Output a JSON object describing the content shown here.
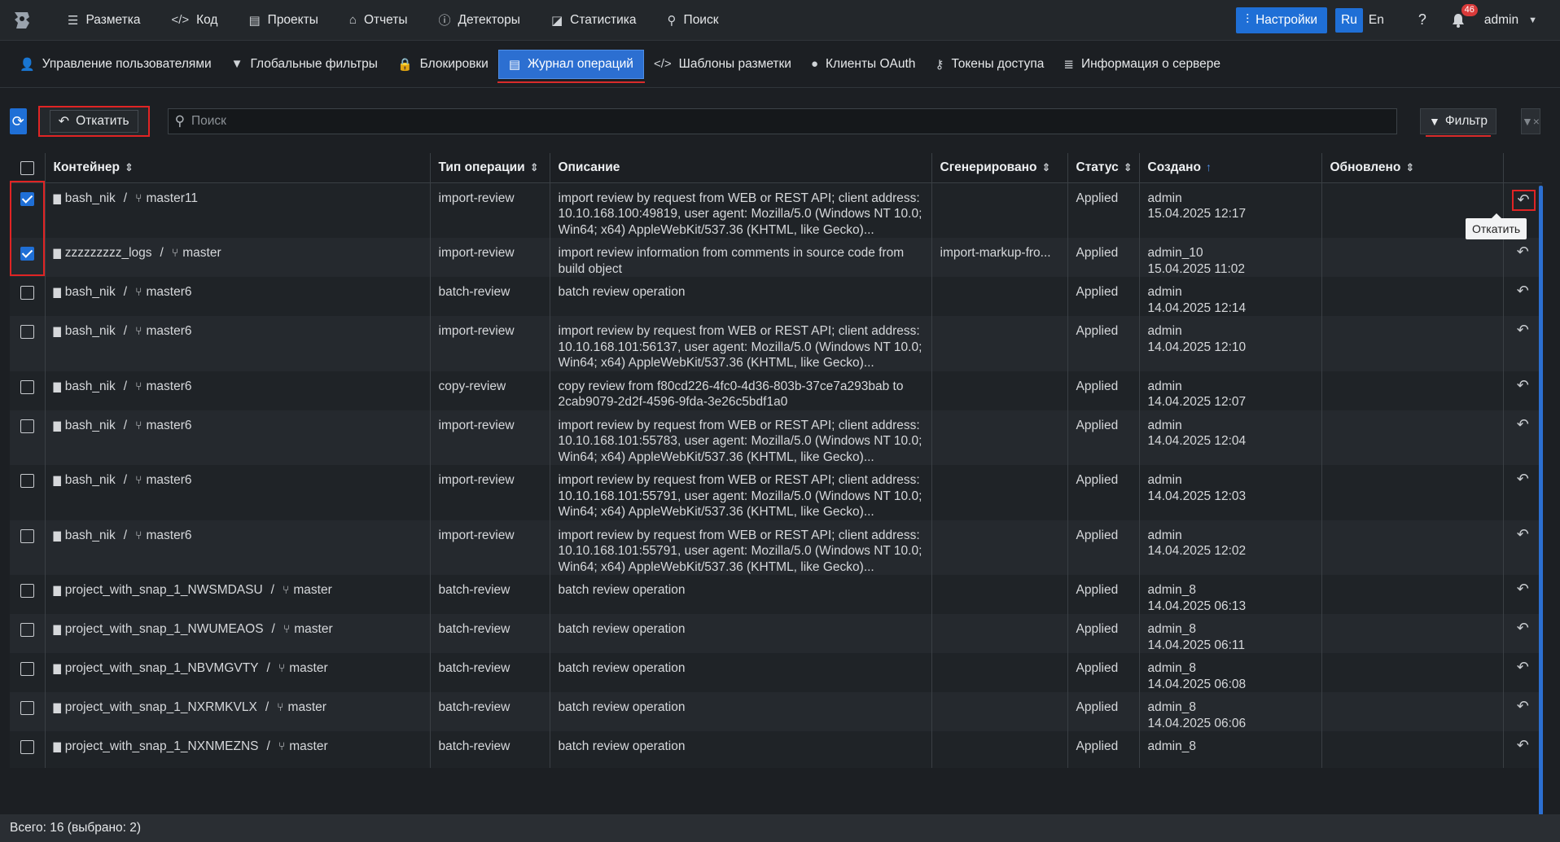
{
  "topnav": {
    "items": [
      {
        "label": "Разметка",
        "icon": "list-icon",
        "glyph": "☰"
      },
      {
        "label": "Код",
        "icon": "code-icon",
        "glyph": "</>"
      },
      {
        "label": "Проекты",
        "icon": "archive-icon",
        "glyph": "▤"
      },
      {
        "label": "Отчеты",
        "icon": "reports-icon",
        "glyph": "⌂"
      },
      {
        "label": "Детекторы",
        "icon": "detector-icon",
        "glyph": "ⓘ"
      },
      {
        "label": "Статистика",
        "icon": "chart-icon",
        "glyph": "◪"
      },
      {
        "label": "Поиск",
        "icon": "search-icon",
        "glyph": "⚲"
      }
    ],
    "settings_label": "Настройки",
    "lang_ru": "Ru",
    "lang_en": "En",
    "notifications_count": "46",
    "user": "admin"
  },
  "subnav": {
    "items": [
      {
        "label": "Управление пользователями",
        "icon": "users-icon",
        "glyph": "👤",
        "active": false
      },
      {
        "label": "Глобальные фильтры",
        "icon": "filter-icon",
        "glyph": "▼",
        "active": false
      },
      {
        "label": "Блокировки",
        "icon": "lock-icon",
        "glyph": "🔒",
        "active": false
      },
      {
        "label": "Журнал операций",
        "icon": "journal-icon",
        "glyph": "▤",
        "active": true
      },
      {
        "label": "Шаблоны разметки",
        "icon": "code-icon",
        "glyph": "</>",
        "active": false
      },
      {
        "label": "Клиенты OAuth",
        "icon": "client-icon",
        "glyph": "●",
        "active": false
      },
      {
        "label": "Токены доступа",
        "icon": "key-icon",
        "glyph": "⚷",
        "active": false
      },
      {
        "label": "Информация о сервере",
        "icon": "database-icon",
        "glyph": "≣",
        "active": false
      }
    ]
  },
  "toolbar": {
    "rollback_label": "Откатить",
    "search_placeholder": "Поиск",
    "filter_label": "Фильтр"
  },
  "table": {
    "columns": {
      "container": "Контейнер",
      "op_type": "Тип операции",
      "description": "Описание",
      "generated": "Сгенерировано",
      "status": "Статус",
      "created": "Создано",
      "updated": "Обновлено"
    },
    "rows": [
      {
        "checked": true,
        "project": "bash_nik",
        "branch": "master11",
        "op_type": "import-review",
        "description": "import review by request from WEB or REST API; client address: 10.10.168.100:49819, user agent: Mozilla/5.0 (Windows NT 10.0; Win64; x64) AppleWebKit/537.36 (KHTML, like Gecko)...",
        "generated": "",
        "status": "Applied",
        "created_by": "admin",
        "created_at": "15.04.2025 12:17",
        "updated": "",
        "height": 3
      },
      {
        "checked": true,
        "project": "zzzzzzzzz_logs",
        "branch": "master",
        "op_type": "import-review",
        "description": "import review information from comments in source code from build object",
        "generated": "import-markup-fro...",
        "status": "Applied",
        "created_by": "admin_10",
        "created_at": "15.04.2025 11:02",
        "updated": "",
        "height": 2
      },
      {
        "checked": false,
        "project": "bash_nik",
        "branch": "master6",
        "op_type": "batch-review",
        "description": "batch review operation",
        "generated": "",
        "status": "Applied",
        "created_by": "admin",
        "created_at": "14.04.2025 12:14",
        "updated": "",
        "height": 2
      },
      {
        "checked": false,
        "project": "bash_nik",
        "branch": "master6",
        "op_type": "import-review",
        "description": "import review by request from WEB or REST API; client address: 10.10.168.101:56137, user agent: Mozilla/5.0 (Windows NT 10.0; Win64; x64) AppleWebKit/537.36 (KHTML, like Gecko)...",
        "generated": "",
        "status": "Applied",
        "created_by": "admin",
        "created_at": "14.04.2025 12:10",
        "updated": "",
        "height": 3
      },
      {
        "checked": false,
        "project": "bash_nik",
        "branch": "master6",
        "op_type": "copy-review",
        "description": "copy review from f80cd226-4fc0-4d36-803b-37ce7a293bab to 2cab9079-2d2f-4596-9fda-3e26c5bdf1a0",
        "generated": "",
        "status": "Applied",
        "created_by": "admin",
        "created_at": "14.04.2025 12:07",
        "updated": "",
        "height": 2
      },
      {
        "checked": false,
        "project": "bash_nik",
        "branch": "master6",
        "op_type": "import-review",
        "description": "import review by request from WEB or REST API; client address: 10.10.168.101:55783, user agent: Mozilla/5.0 (Windows NT 10.0; Win64; x64) AppleWebKit/537.36 (KHTML, like Gecko)...",
        "generated": "",
        "status": "Applied",
        "created_by": "admin",
        "created_at": "14.04.2025 12:04",
        "updated": "",
        "height": 3
      },
      {
        "checked": false,
        "project": "bash_nik",
        "branch": "master6",
        "op_type": "import-review",
        "description": "import review by request from WEB or REST API; client address: 10.10.168.101:55791, user agent: Mozilla/5.0 (Windows NT 10.0; Win64; x64) AppleWebKit/537.36 (KHTML, like Gecko)...",
        "generated": "",
        "status": "Applied",
        "created_by": "admin",
        "created_at": "14.04.2025 12:03",
        "updated": "",
        "height": 3
      },
      {
        "checked": false,
        "project": "bash_nik",
        "branch": "master6",
        "op_type": "import-review",
        "description": "import review by request from WEB or REST API; client address: 10.10.168.101:55791, user agent: Mozilla/5.0 (Windows NT 10.0; Win64; x64) AppleWebKit/537.36 (KHTML, like Gecko)...",
        "generated": "",
        "status": "Applied",
        "created_by": "admin",
        "created_at": "14.04.2025 12:02",
        "updated": "",
        "height": 3
      },
      {
        "checked": false,
        "project": "project_with_snap_1_NWSMDASU",
        "branch": "master",
        "op_type": "batch-review",
        "description": "batch review operation",
        "generated": "",
        "status": "Applied",
        "created_by": "admin_8",
        "created_at": "14.04.2025 06:13",
        "updated": "",
        "height": 2
      },
      {
        "checked": false,
        "project": "project_with_snap_1_NWUMEAOS",
        "branch": "master",
        "op_type": "batch-review",
        "description": "batch review operation",
        "generated": "",
        "status": "Applied",
        "created_by": "admin_8",
        "created_at": "14.04.2025 06:11",
        "updated": "",
        "height": 2
      },
      {
        "checked": false,
        "project": "project_with_snap_1_NBVMGVTY",
        "branch": "master",
        "op_type": "batch-review",
        "description": "batch review operation",
        "generated": "",
        "status": "Applied",
        "created_by": "admin_8",
        "created_at": "14.04.2025 06:08",
        "updated": "",
        "height": 2
      },
      {
        "checked": false,
        "project": "project_with_snap_1_NXRMKVLX",
        "branch": "master",
        "op_type": "batch-review",
        "description": "batch review operation",
        "generated": "",
        "status": "Applied",
        "created_by": "admin_8",
        "created_at": "14.04.2025 06:06",
        "updated": "",
        "height": 2
      },
      {
        "checked": false,
        "project": "project_with_snap_1_NXNMEZNS",
        "branch": "master",
        "op_type": "batch-review",
        "description": "batch review operation",
        "generated": "",
        "status": "Applied",
        "created_by": "admin_8",
        "created_at": "",
        "updated": "",
        "height": 2
      }
    ]
  },
  "tooltip": "Откатить",
  "footer": "Всего: 16 (выбрано: 2)"
}
